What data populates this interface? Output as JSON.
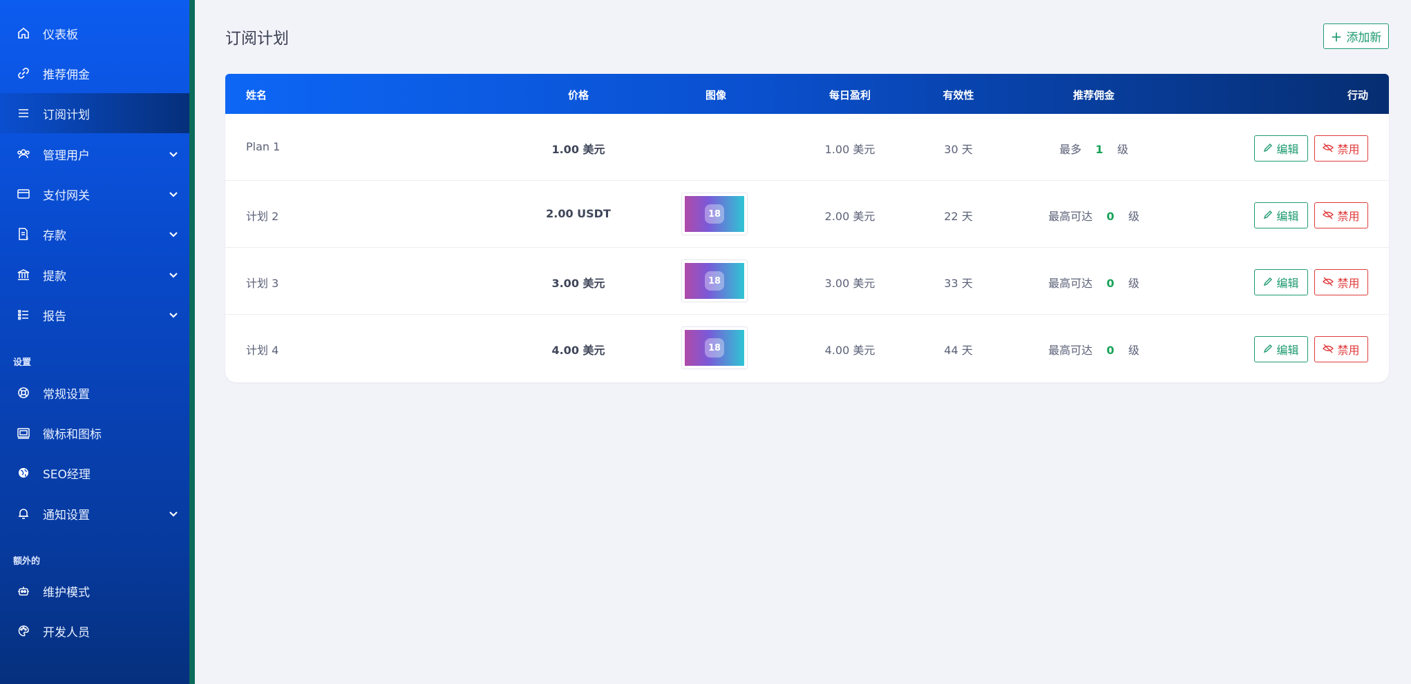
{
  "sidebar": {
    "items": [
      {
        "label": "仪表板",
        "icon": "home-icon"
      },
      {
        "label": "推荐佣金",
        "icon": "link-icon"
      },
      {
        "label": "订阅计划",
        "icon": "list-icon"
      },
      {
        "label": "管理用户",
        "icon": "users-icon"
      },
      {
        "label": "支付网关",
        "icon": "credit-card-icon"
      },
      {
        "label": "存款",
        "icon": "deposit-icon"
      },
      {
        "label": "提款",
        "icon": "bank-icon"
      },
      {
        "label": "报告",
        "icon": "report-icon"
      },
      {
        "label": "常规设置",
        "icon": "lifebuoy-icon"
      },
      {
        "label": "徽标和图标",
        "icon": "logo-icon"
      },
      {
        "label": "SEO经理",
        "icon": "globe-icon"
      },
      {
        "label": "通知设置",
        "icon": "bell-icon"
      },
      {
        "label": "维护模式",
        "icon": "robot-icon"
      },
      {
        "label": "开发人员",
        "icon": "palette-icon"
      }
    ],
    "section_settings": "设置",
    "section_extra": "额外的"
  },
  "main": {
    "title": "订阅计划",
    "add_button": "添加新"
  },
  "table": {
    "headers": {
      "name": "姓名",
      "price": "价格",
      "image": "图像",
      "daily_profit": "每日盈利",
      "validity": "有效性",
      "referral": "推荐佣金",
      "action": "行动"
    },
    "rows": [
      {
        "name": "Plan 1",
        "price": "1.00 美元",
        "has_image": false,
        "daily_profit": "1.00 美元",
        "validity": "30 天",
        "ref_prefix": "最多",
        "ref_level": "1",
        "ref_suffix": "级",
        "edit": "编辑",
        "disable": "禁用"
      },
      {
        "name": "计划 2",
        "price": "2.00 USDT",
        "has_image": true,
        "image_label": "18",
        "daily_profit": "2.00 美元",
        "validity": "22 天",
        "ref_prefix": "最高可达",
        "ref_level": "0",
        "ref_suffix": "级",
        "edit": "编辑",
        "disable": "禁用"
      },
      {
        "name": "计划 3",
        "price": "3.00 美元",
        "has_image": true,
        "image_label": "18",
        "daily_profit": "3.00 美元",
        "validity": "33 天",
        "ref_prefix": "最高可达",
        "ref_level": "0",
        "ref_suffix": "级",
        "edit": "编辑",
        "disable": "禁用"
      },
      {
        "name": "计划 4",
        "price": "4.00 美元",
        "has_image": true,
        "image_label": "18",
        "daily_profit": "4.00 美元",
        "validity": "44 天",
        "ref_prefix": "最高可达",
        "ref_level": "0",
        "ref_suffix": "级",
        "edit": "编辑",
        "disable": "禁用"
      }
    ]
  },
  "colors": {
    "accent_green": "#1c9a6e",
    "danger_red": "#e03a3a",
    "sidebar_blue": "#0d5cf0"
  }
}
